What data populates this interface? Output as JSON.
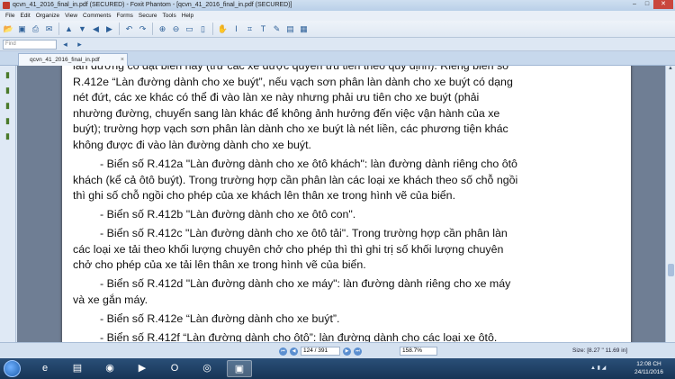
{
  "window": {
    "title": "qcvn_41_2016_final_in.pdf (SECURED) - Foxit Phantom - [qcvn_41_2016_final_in.pdf (SECURED)]"
  },
  "menu": {
    "items": [
      "File",
      "Edit",
      "Organize",
      "View",
      "Comments",
      "Forms",
      "Secure",
      "Tools",
      "Help"
    ]
  },
  "find": {
    "placeholder": "Find"
  },
  "tab": {
    "label": "qcvn_41_2016_final_in.pdf (SECURED)"
  },
  "document": {
    "lines": [
      "làn đường có đặt biển này (trừ các xe được quyền ưu tiên theo quy định). Riêng biển số",
      "R.412e “Làn đường dành cho xe buýt”, nếu vạch sơn phân làn dành cho xe buýt có dạng",
      "nét đứt, các xe khác có thể đi vào làn xe này nhưng phải ưu tiên cho xe buýt (phải",
      "nhường đường, chuyển sang làn khác để không ảnh hưởng đến việc vận hành của xe",
      "buýt); trường hợp vạch sơn phân làn dành cho xe buýt là nét liền, các phương tiện khác",
      "không được đi vào làn đường dành cho xe buýt.",
      "- Biển số R.412a \"Làn đường dành cho xe ôtô khách\": làn đường dành riêng cho ôtô",
      "khách (kể cả ôtô buýt). Trong trường hợp cần phân làn các loại xe khách theo số chỗ ngồi",
      "thì ghi số chỗ ngồi cho phép của xe khách lên thân xe trong hình vẽ của biển.",
      "- Biển số R.412b \"Làn đường dành cho xe ôtô con\".",
      "- Biển số R.412c \"Làn đường dành cho xe ôtô tải\". Trong trường hợp cần phân làn",
      "các loại xe tải theo khối lượng chuyên chở cho phép thì thì ghi trị số khối lượng chuyên",
      "chở cho phép của xe tải lên thân xe trong hình vẽ của biển.",
      "- Biển số R.412d \"Làn đường dành cho xe máy\": làn đường dành riêng cho xe máy",
      "và xe gắn máy.",
      "- Biển số R.412e “Làn đường dành cho xe buýt”.",
      "- Biển số R.412f “Làn đường dành cho ôtô”: làn đường dành cho các loại xe ôtô."
    ]
  },
  "status": {
    "page": "124 / 391",
    "zoom": "158.7%",
    "size": "Size: [8.27 \" 11.69 in]"
  },
  "taskbar": {
    "time": "12:08 CH",
    "date": "24/11/2016"
  }
}
